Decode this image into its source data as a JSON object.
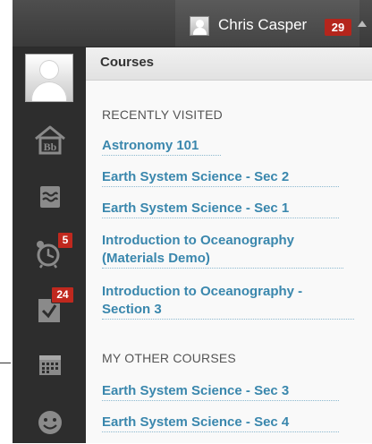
{
  "header": {
    "user_name": "Chris Casper",
    "notification_count": "29"
  },
  "rail": {
    "alerts_badge": "5",
    "tasks_badge": "24"
  },
  "panel": {
    "title": "Courses",
    "recent_heading": "RECENTLY VISITED",
    "recent_courses": [
      {
        "label": "Astronomy 101"
      },
      {
        "label": "Earth System Science - Sec 2"
      },
      {
        "label": "Earth System Science - Sec 1"
      },
      {
        "label_line1": "Introduction to Oceanography",
        "label_line2": "(Materials Demo)"
      },
      {
        "label_line1": "Introduction to Oceanography -",
        "label_line2": "Section 3"
      }
    ],
    "other_heading": "MY OTHER COURSES",
    "other_courses": [
      {
        "label": "Earth System Science - Sec 3"
      },
      {
        "label": "Earth System Science - Sec 4"
      }
    ]
  },
  "colors": {
    "link": "#3a87ad",
    "badge": "#b5251c",
    "rail": "#2d2d2d"
  }
}
